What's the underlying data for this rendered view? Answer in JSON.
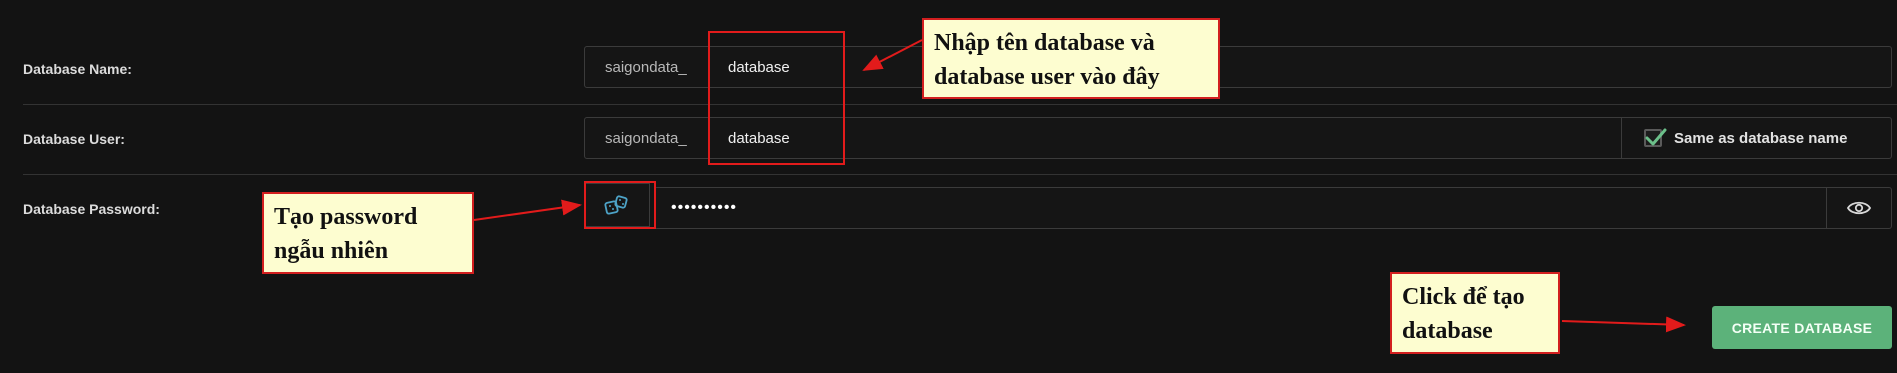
{
  "form": {
    "name_label": "Database Name:",
    "name_prefix": "saigondata_",
    "name_value": "database",
    "user_label": "Database User:",
    "user_prefix": "saigondata_",
    "user_value": "database",
    "same_as_label": "Same as database name",
    "same_as_checked": true,
    "password_label": "Database Password:",
    "password_value": "••••••••••",
    "create_label": "CREATE DATABASE"
  },
  "annotations": {
    "note_name": "Nhập tên database và database user vào đây",
    "note_password": "Tạo password ngẫu nhiên",
    "note_create": "Click để tạo database"
  },
  "icons": {
    "generate": "dice-icon",
    "show_password": "eye-icon",
    "checkbox": "checkmark-icon"
  },
  "colors": {
    "accent": "#5cb27a",
    "annotation_border": "#d21f1f",
    "annotation_bg": "#fdfdd0"
  }
}
